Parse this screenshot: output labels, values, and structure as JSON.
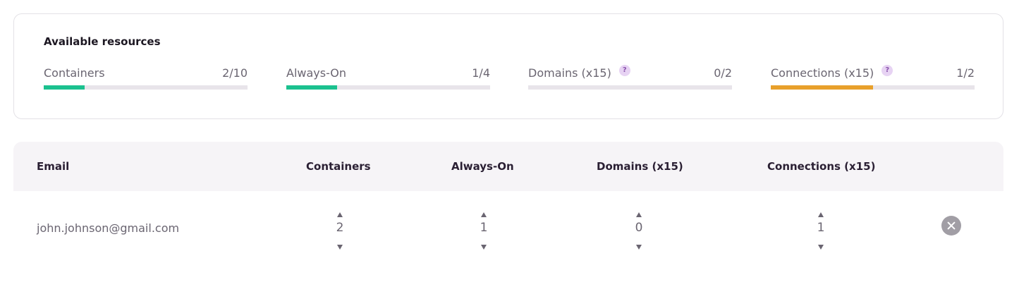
{
  "resources": {
    "title": "Available resources",
    "items": [
      {
        "label": "Containers",
        "value": "2/10",
        "fraction": 0.2,
        "color": "#1bc18f",
        "help": false
      },
      {
        "label": "Always-On",
        "value": "1/4",
        "fraction": 0.25,
        "color": "#1bc18f",
        "help": false
      },
      {
        "label": "Domains (x15)",
        "value": "0/2",
        "fraction": 0.0,
        "color": "#1bc18f",
        "help": true,
        "help_icon": "question-icon"
      },
      {
        "label": "Connections (x15)",
        "value": "1/2",
        "fraction": 0.5,
        "color": "#e8a02b",
        "help": true,
        "help_icon": "question-icon"
      }
    ]
  },
  "table": {
    "headers": {
      "email": "Email",
      "containers": "Containers",
      "always_on": "Always-On",
      "domains": "Domains (x15)",
      "connections": "Connections (x15)"
    },
    "rows": [
      {
        "email": "john.johnson@gmail.com",
        "containers": "2",
        "always_on": "1",
        "domains": "0",
        "connections": "1",
        "remove_icon": "close-icon"
      }
    ]
  },
  "help_glyph": "?"
}
